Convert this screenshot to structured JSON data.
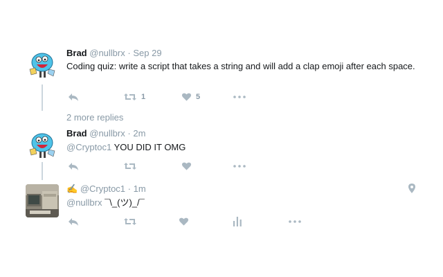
{
  "thread": {
    "more_replies": "2 more replies"
  },
  "tweets": [
    {
      "name": "Brad",
      "handle": "@nullbrx",
      "separator": "·",
      "time": "Sep 29",
      "text": "Coding quiz: write a script that takes a string and will add a clap emoji after each space.",
      "actions": {
        "retweets": "1",
        "likes": "5"
      }
    },
    {
      "name": "Brad",
      "handle": "@nullbrx",
      "separator": "·",
      "time": "2m",
      "mention": "@Cryptoc1",
      "text": "YOU DID IT OMG"
    },
    {
      "prefix_emoji": "✍",
      "handle": "@Cryptoc1",
      "separator": "·",
      "time": "1m",
      "mention": "@nullbrx",
      "text": "¯\\_(ツ)_/¯"
    }
  ],
  "icons": {
    "reply": "reply-icon",
    "retweet": "retweet-icon",
    "like": "heart-icon",
    "more": "more-icon",
    "analytics": "analytics-icon",
    "location": "location-pin-icon"
  },
  "colors": {
    "icon": "#aab8c2",
    "meta": "#8899a6",
    "text": "#14171a",
    "thread_line": "#ccd6dd",
    "avatar_blue": "#4fc3e8"
  }
}
